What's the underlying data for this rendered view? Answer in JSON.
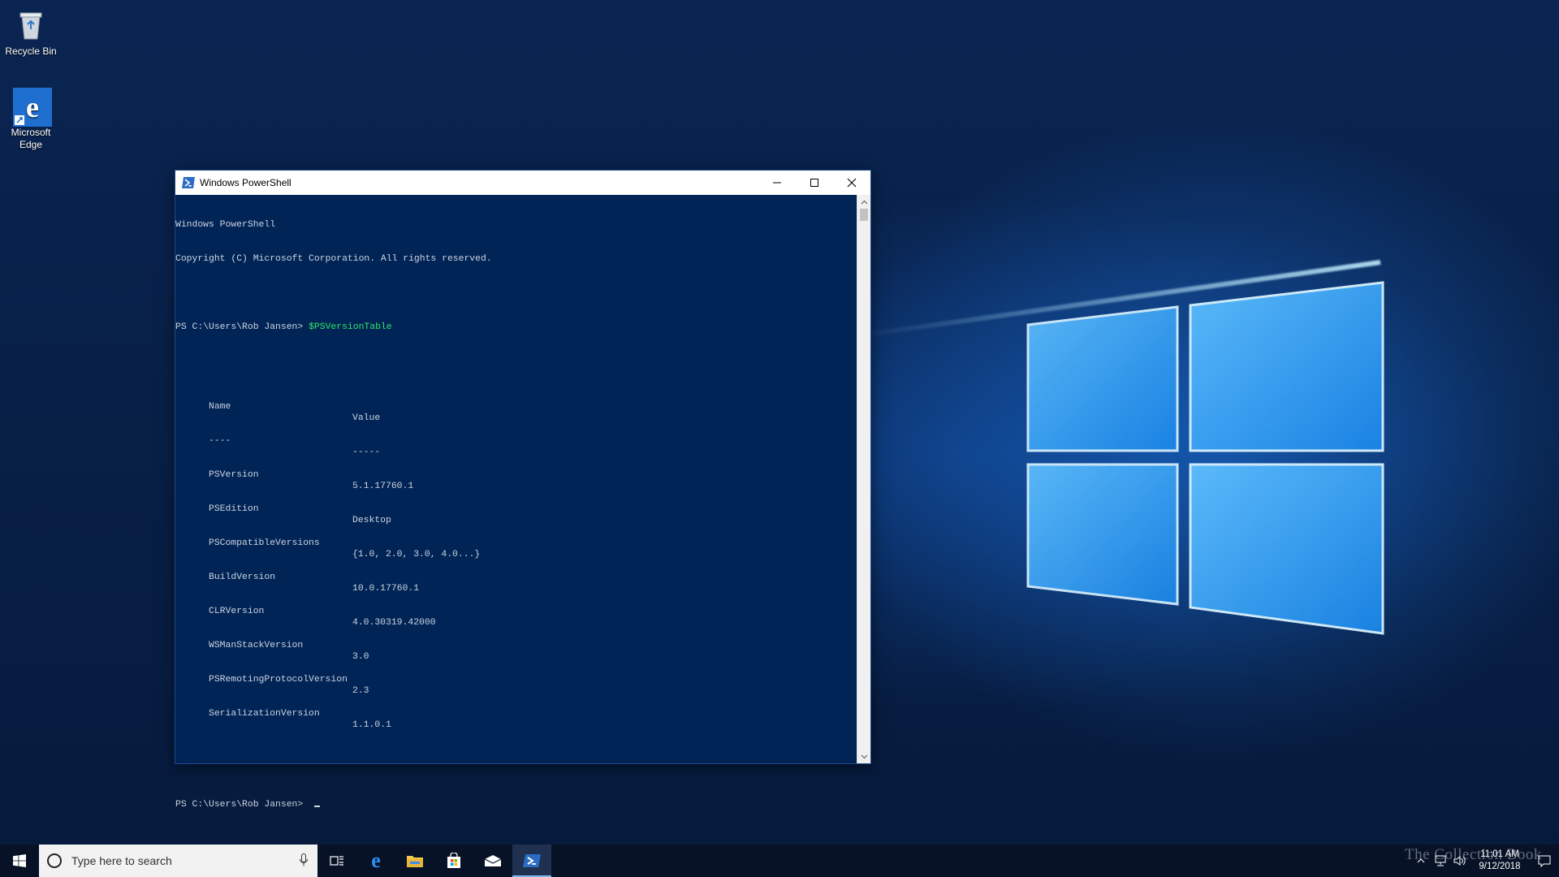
{
  "desktop": {
    "icons": [
      {
        "label": "Recycle Bin",
        "icon": "recycle-bin-icon"
      },
      {
        "label": "Microsoft Edge",
        "icon": "edge-icon"
      }
    ]
  },
  "window": {
    "title": "Windows PowerShell",
    "app_icon": "powershell-icon",
    "controls": {
      "minimize": "minimize-icon",
      "maximize": "maximize-icon",
      "close": "close-icon"
    }
  },
  "console": {
    "banner": [
      "Windows PowerShell",
      "Copyright (C) Microsoft Corporation. All rights reserved."
    ],
    "prompt": "PS C:\\Users\\Rob Jansen> ",
    "command": "$PSVersionTable",
    "table": {
      "headers": [
        "Name",
        "Value"
      ],
      "dividers": [
        "----",
        "-----"
      ],
      "rows": [
        [
          "PSVersion",
          "5.1.17760.1"
        ],
        [
          "PSEdition",
          "Desktop"
        ],
        [
          "PSCompatibleVersions",
          "{1.0, 2.0, 3.0, 4.0...}"
        ],
        [
          "BuildVersion",
          "10.0.17760.1"
        ],
        [
          "CLRVersion",
          "4.0.30319.42000"
        ],
        [
          "WSManStackVersion",
          "3.0"
        ],
        [
          "PSRemotingProtocolVersion",
          "2.3"
        ],
        [
          "SerializationVersion",
          "1.1.0.1"
        ]
      ]
    },
    "final_prompt": "PS C:\\Users\\Rob Jansen> ",
    "colors": {
      "background": "#012456",
      "text": "#ccd4e0",
      "command": "#2ee66a"
    }
  },
  "taskbar": {
    "search_placeholder": "Type here to search",
    "apps": [
      "task-view-icon",
      "edge-icon",
      "file-explorer-icon",
      "store-icon",
      "mail-icon",
      "powershell-icon"
    ],
    "active_app": "powershell-icon",
    "clock": {
      "time": "11:01 AM",
      "date": "9/12/2018"
    },
    "watermark": "The Collection Book"
  }
}
